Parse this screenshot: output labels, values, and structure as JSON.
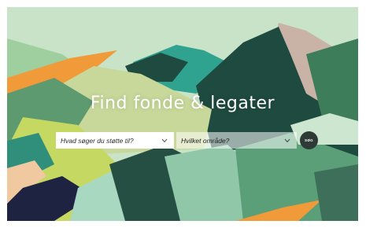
{
  "hero": {
    "title": "Find fonde & legater"
  },
  "search": {
    "support_placeholder": "Hvad søger du støtte til?",
    "area_placeholder": "Hvilket område?",
    "submit_label": "SØG",
    "chevron_icon": "chevron-down-icon"
  },
  "colors": {
    "sky": "#c9e3c8",
    "dark_green": "#1f4a3f",
    "mid_green": "#5d9a6f",
    "pale_green": "#c7d89a",
    "orange": "#f09a3a",
    "pink": "#c9b3a7",
    "navy": "#1d2340",
    "lime": "#c5d861",
    "teal": "#2fa38f",
    "button": "#2f3a36"
  }
}
